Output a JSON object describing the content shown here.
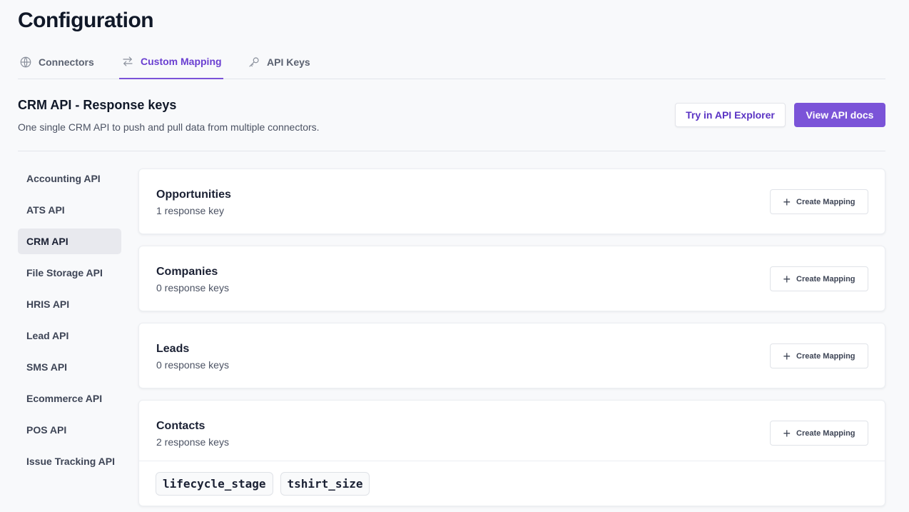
{
  "page": {
    "title": "Configuration"
  },
  "tabs": [
    {
      "label": "Connectors",
      "icon": "globe-icon"
    },
    {
      "label": "Custom Mapping",
      "icon": "swap-arrows-icon",
      "active": true
    },
    {
      "label": "API Keys",
      "icon": "key-icon"
    }
  ],
  "section": {
    "title": "CRM API - Response keys",
    "subtitle": "One single CRM API to push and pull data from multiple connectors.",
    "explorer_button": "Try in API Explorer",
    "docs_button": "View API docs"
  },
  "sidebar": {
    "items": [
      {
        "label": "Accounting API"
      },
      {
        "label": "ATS API"
      },
      {
        "label": "CRM API",
        "active": true
      },
      {
        "label": "File Storage API"
      },
      {
        "label": "HRIS API"
      },
      {
        "label": "Lead API"
      },
      {
        "label": "SMS API"
      },
      {
        "label": "Ecommerce API"
      },
      {
        "label": "POS API"
      },
      {
        "label": "Issue Tracking API"
      }
    ]
  },
  "cards": [
    {
      "title": "Opportunities",
      "count": "1 response key",
      "button": "Create Mapping"
    },
    {
      "title": "Companies",
      "count": "0 response keys",
      "button": "Create Mapping"
    },
    {
      "title": "Leads",
      "count": "0 response keys",
      "button": "Create Mapping"
    },
    {
      "title": "Contacts",
      "count": "2 response keys",
      "button": "Create Mapping",
      "keys": [
        "lifecycle_stage",
        "tshirt_size"
      ]
    }
  ],
  "colors": {
    "accent": "#7b54d8",
    "accent_text": "#6a3fd1",
    "background": "#f8f9fb"
  }
}
